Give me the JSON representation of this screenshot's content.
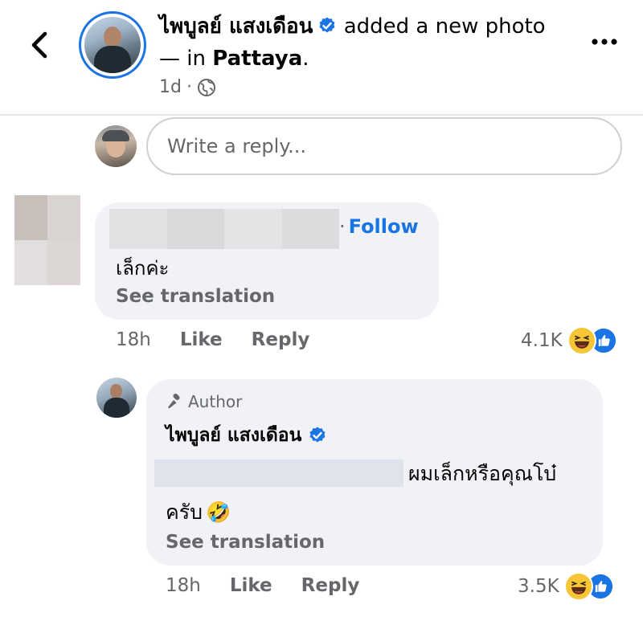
{
  "header": {
    "author": "ไพบูลย์ แสงเดือน",
    "action_text": "added a new photo — in",
    "location": "Pattaya",
    "location_suffix": ".",
    "time": "1d",
    "separator": "·",
    "audience_icon": "globe-icon",
    "more_icon": "more-dots-icon",
    "back_icon": "chevron-left-icon"
  },
  "composer": {
    "placeholder": "Write a reply..."
  },
  "comments": [
    {
      "follow_sep": "·",
      "follow_label": "Follow",
      "text": "เล็กค่ะ",
      "see_translation": "See translation",
      "time": "18h",
      "like_label": "Like",
      "reply_label": "Reply",
      "reaction_count": "4.1K",
      "reaction_icons": [
        "haha-icon",
        "like-icon"
      ]
    },
    {
      "badge": "Author",
      "badge_icon": "microphone-icon",
      "author": "ไพบูลย์ แสงเดือน",
      "text_line1": "ผมเล็กหรือคุณโบ๋",
      "text_line2": "ครับ",
      "text_emoji": "🤣",
      "see_translation": "See translation",
      "time": "18h",
      "like_label": "Like",
      "reply_label": "Reply",
      "reaction_count": "3.5K",
      "reaction_icons": [
        "haha-icon",
        "like-icon"
      ]
    }
  ],
  "colors": {
    "brand_blue": "#1b74e4",
    "secondary_text": "#65676b",
    "bubble_bg": "#f0f2f5",
    "haha_yellow": "#f7c536"
  }
}
